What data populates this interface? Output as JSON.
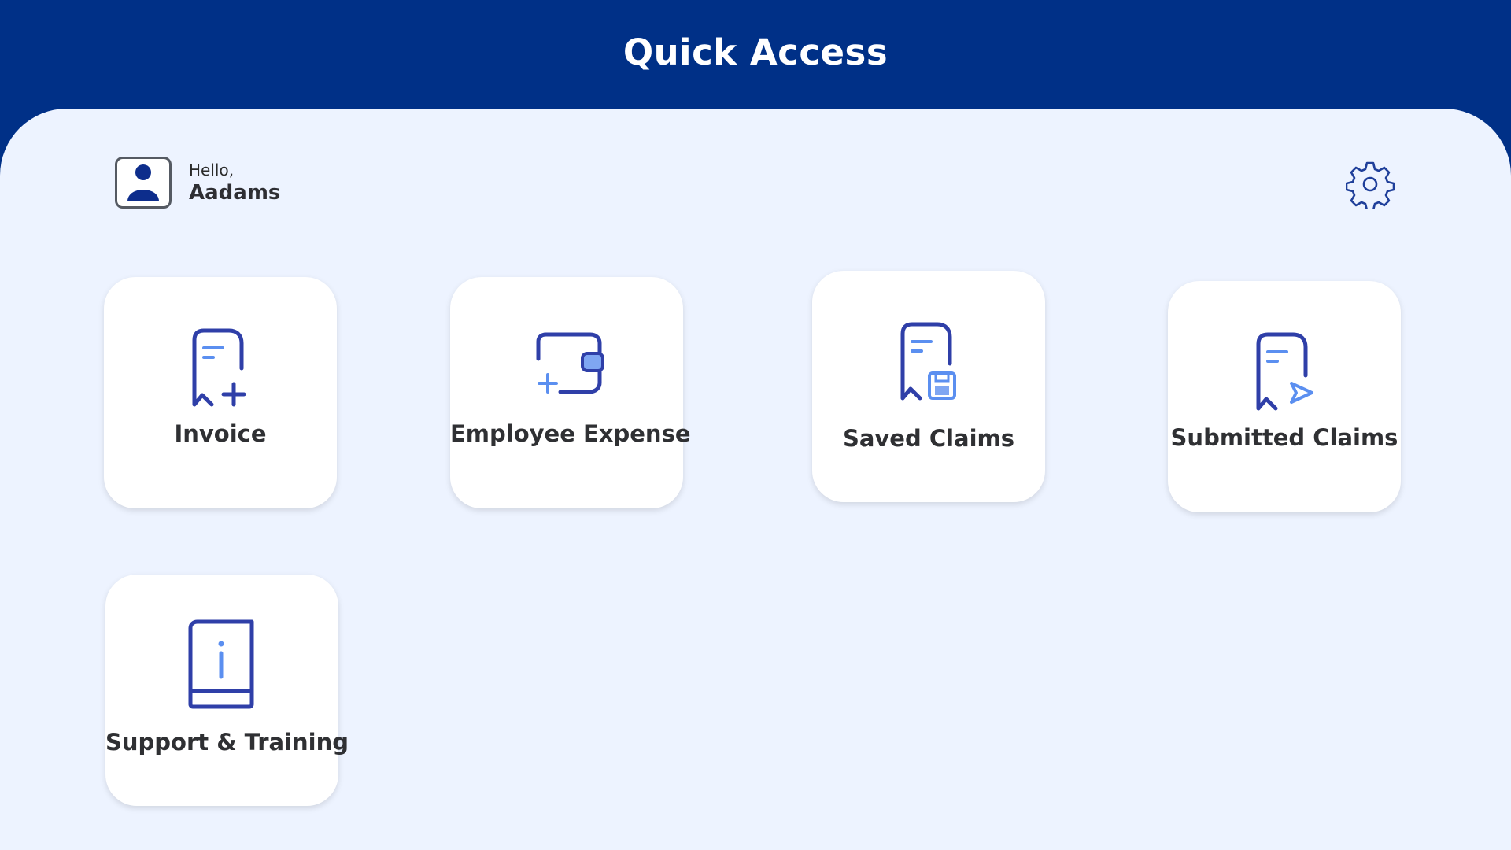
{
  "header": {
    "title": "Quick Access"
  },
  "user": {
    "greeting": "Hello,",
    "name": "Aadams",
    "avatar_icon": "user-icon"
  },
  "settings": {
    "icon": "gear-icon"
  },
  "tiles": [
    {
      "label": "Invoice",
      "icon": "invoice-add-icon"
    },
    {
      "label": "Employee Expense",
      "icon": "wallet-add-icon"
    },
    {
      "label": "Saved Claims",
      "icon": "receipt-save-icon"
    },
    {
      "label": "Submitted Claims",
      "icon": "receipt-send-icon"
    },
    {
      "label": "Support & Training",
      "icon": "info-book-icon"
    }
  ],
  "colors": {
    "header_bg": "#003087",
    "panel_bg": "#edf3ff",
    "icon_dark": "#2f3fa8",
    "icon_light": "#5b8ff0",
    "text": "#2f3033"
  }
}
